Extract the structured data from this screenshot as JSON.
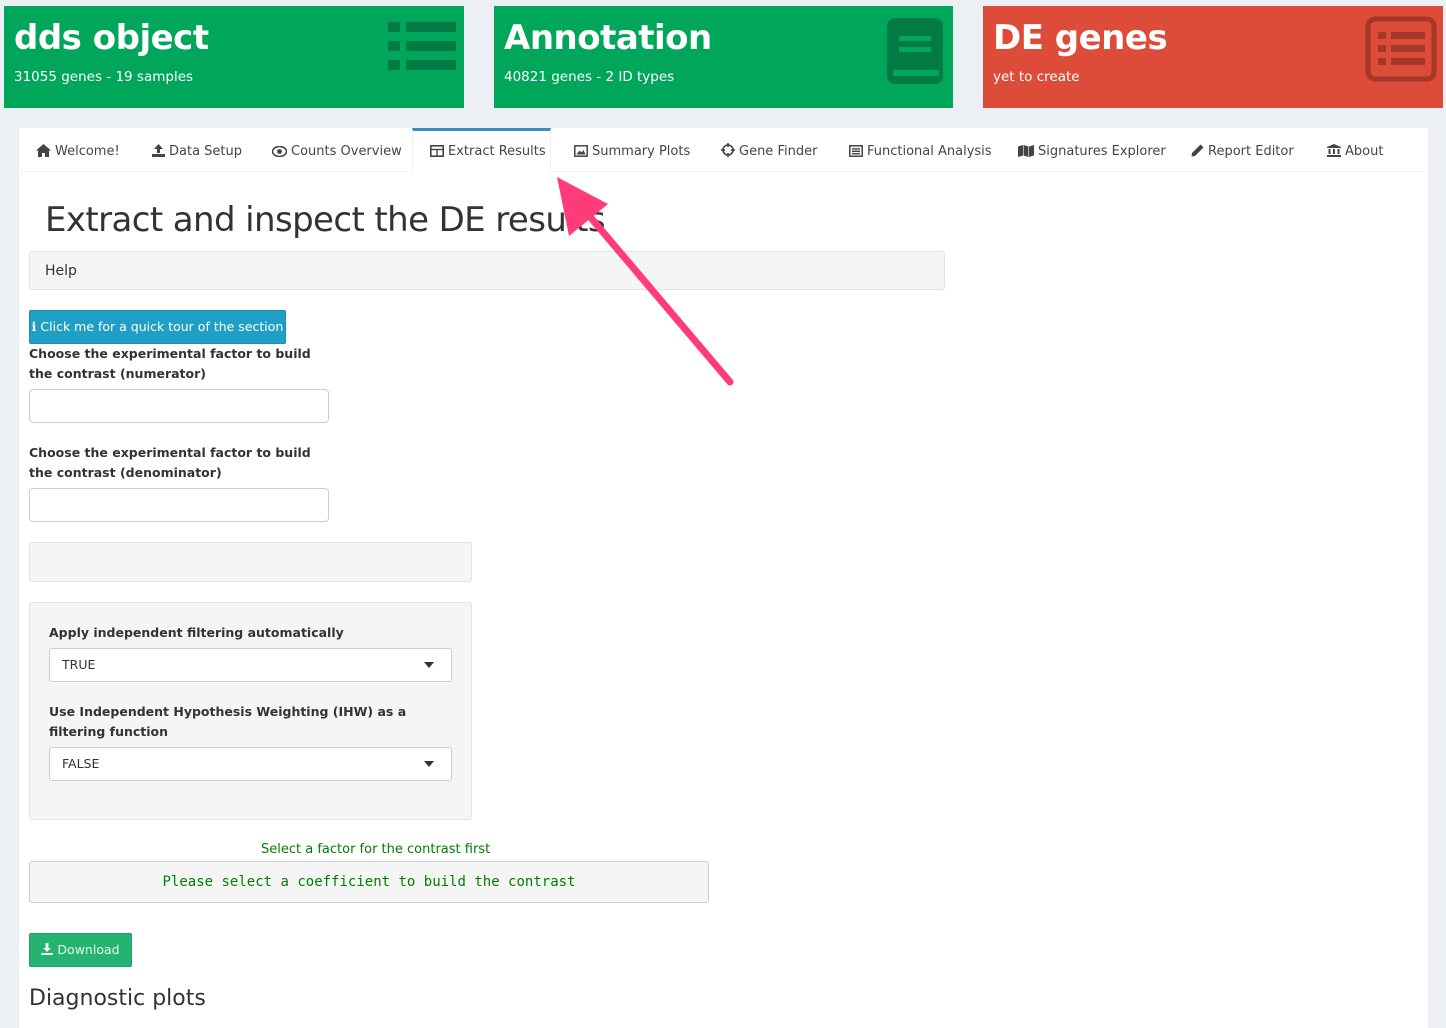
{
  "value_boxes": [
    {
      "value": "dds object",
      "subtitle": "31055 genes - 19 samples",
      "icon": "list-icon",
      "color": "#00a65a"
    },
    {
      "value": "Annotation",
      "subtitle": "40821 genes - 2 ID types",
      "icon": "book-icon",
      "color": "#00a65a"
    },
    {
      "value": "DE genes",
      "subtitle": "yet to create",
      "icon": "list-alt-icon",
      "color": "#dd4b39"
    }
  ],
  "tabs": [
    {
      "label": "Welcome!",
      "icon": "home-icon"
    },
    {
      "label": "Data Setup",
      "icon": "upload-icon"
    },
    {
      "label": "Counts Overview",
      "icon": "eye-icon"
    },
    {
      "label": "Extract Results",
      "icon": "table-icon",
      "active": true
    },
    {
      "label": "Summary Plots",
      "icon": "image-icon"
    },
    {
      "label": "Gene Finder",
      "icon": "crosshairs-icon"
    },
    {
      "label": "Functional Analysis",
      "icon": "list-alt-icon"
    },
    {
      "label": "Signatures Explorer",
      "icon": "map-icon"
    },
    {
      "label": "Report Editor",
      "icon": "pencil-icon"
    },
    {
      "label": "About",
      "icon": "institution-icon"
    }
  ],
  "main": {
    "title": "Extract and inspect the DE results",
    "help_label": "Help",
    "tour_button": "Click me for a quick tour of the section",
    "numerator_label": "Choose the experimental factor to build the contrast (numerator)",
    "numerator_value": "",
    "denominator_label": "Choose the experimental factor to build the contrast (denominator)",
    "denominator_value": "",
    "filtering_label": "Apply independent filtering automatically",
    "filtering_value": "TRUE",
    "ihw_label": "Use Independent Hypothesis Weighting (IHW) as a filtering function",
    "ihw_value": "FALSE",
    "status_message": "Select a factor for the contrast first",
    "contrast_output": "Please select a coefficient to build the contrast",
    "download_label": "Download",
    "diagnostic_title": "Diagnostic plots"
  },
  "annotation_arrow_color": "#ff3b7a"
}
